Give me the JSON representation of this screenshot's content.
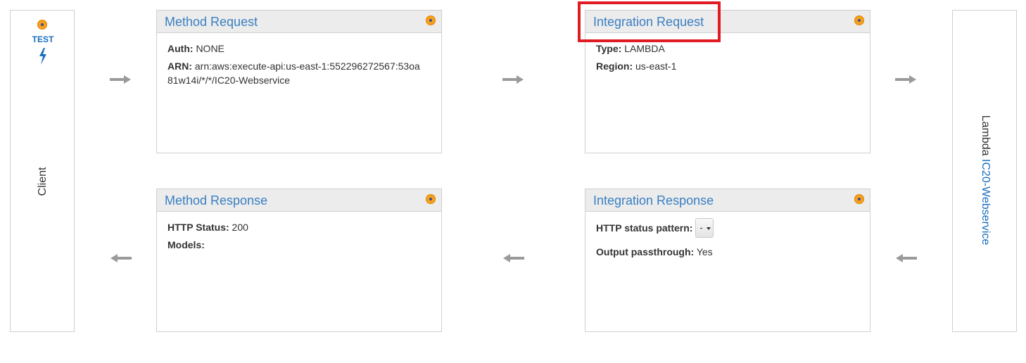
{
  "client": {
    "test_label": "TEST",
    "label": "Client"
  },
  "method_request": {
    "title": "Method Request",
    "auth_label": "Auth:",
    "auth_value": "NONE",
    "arn_label": "ARN:",
    "arn_value": "arn:aws:execute-api:us-east-1:552296272567:53oa81w14i/*/*/IC20-Webservice"
  },
  "integration_request": {
    "title": "Integration Request",
    "type_label": "Type:",
    "type_value": "LAMBDA",
    "region_label": "Region:",
    "region_value": "us-east-1"
  },
  "lambda": {
    "prefix": "Lambda",
    "function_name": "IC20-Webservice"
  },
  "method_response": {
    "title": "Method Response",
    "status_label": "HTTP Status:",
    "status_value": "200",
    "models_label": "Models:"
  },
  "integration_response": {
    "title": "Integration Response",
    "pattern_label": "HTTP status pattern:",
    "pattern_value": "-",
    "passthrough_label": "Output passthrough:",
    "passthrough_value": "Yes"
  },
  "colors": {
    "link": "#3a7fc1",
    "highlight": "#e01b24",
    "settings_dot": "#f6a11d"
  }
}
